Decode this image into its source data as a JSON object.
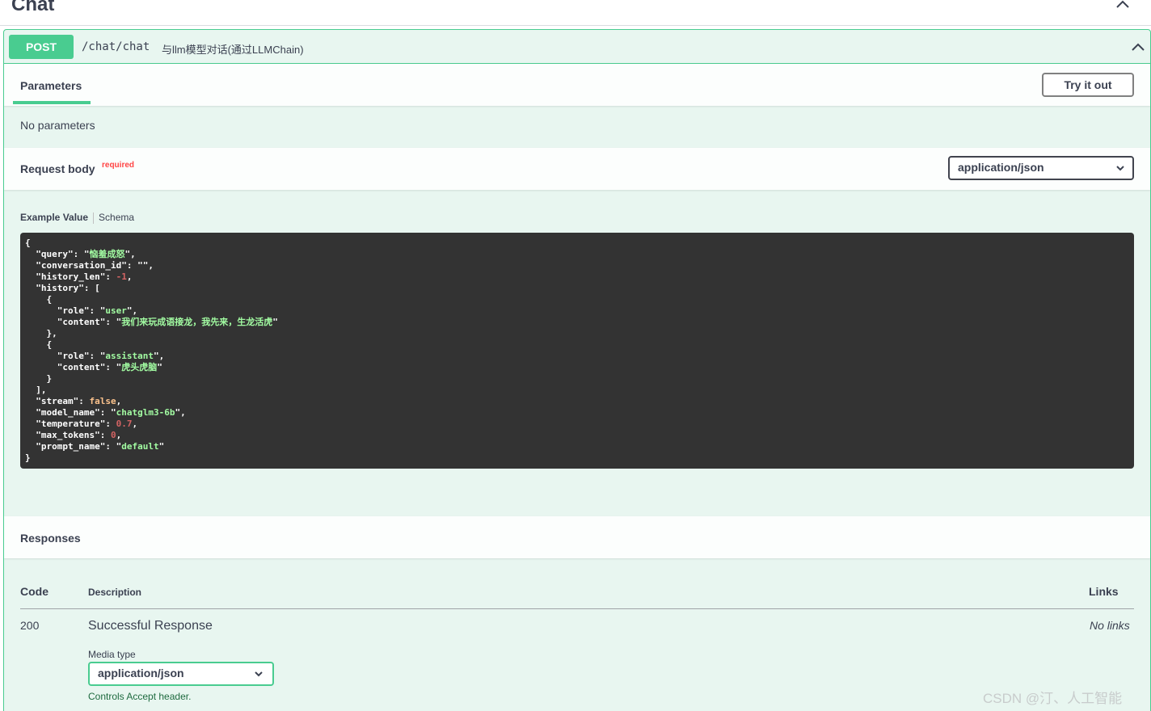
{
  "tag": {
    "title": "Chat"
  },
  "operation": {
    "method": "POST",
    "path": "/chat/chat",
    "summary": "与llm模型对话(通过LLMChain)"
  },
  "parameters": {
    "tab_label": "Parameters",
    "try_button": "Try it out",
    "empty_text": "No parameters"
  },
  "request_body": {
    "title": "Request body",
    "required_label": "required",
    "content_type": "application/json",
    "example_tab": "Example Value",
    "schema_tab": "Schema"
  },
  "example": {
    "query": "恼羞成怒",
    "conversation_id": "",
    "history_len": "-1",
    "history_0_role": "user",
    "history_0_content": "我们来玩成语接龙，我先来，生龙活虎",
    "history_1_role": "assistant",
    "history_1_content": "虎头虎脑",
    "stream": "false",
    "model_name": "chatglm3-6b",
    "temperature": "0.7",
    "max_tokens": "0",
    "prompt_name": "default"
  },
  "responses": {
    "title": "Responses",
    "col_code": "Code",
    "col_description": "Description",
    "col_links": "Links",
    "code": "200",
    "description": "Successful Response",
    "links": "No links",
    "media_type_label": "Media type",
    "media_type_value": "application/json",
    "accept_note": "Controls Accept header."
  },
  "watermark": "CSDN @汀、人工智能",
  "colors": {
    "post": "#49cc90",
    "code_bg": "#333333",
    "opblock_bg": "#e8f6f0"
  }
}
